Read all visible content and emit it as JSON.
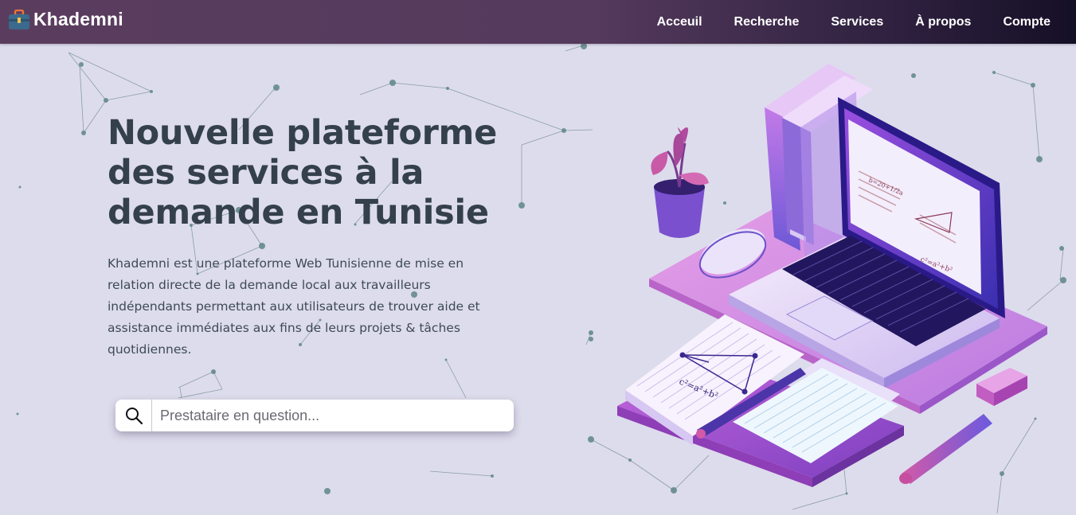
{
  "navbar": {
    "brand": "Khademni",
    "brand_icon": "briefcase-icon",
    "links": [
      "Acceuil",
      "Recherche",
      "Services",
      "À propos",
      "Compte"
    ],
    "gradient": [
      "#5a3d5e",
      "#150f26"
    ]
  },
  "hero": {
    "title": "Nouvelle plateforme des services à la demande en Tunisie",
    "description": "Khademni est une plateforme Web Tunisienne de mise en relation directe de la demande local aux travailleurs indépendants permettant aux utilisateurs de trouver aide et assistance immédiates aux fins de leurs projets & tâches quotidiennes."
  },
  "search": {
    "icon": "search-icon",
    "placeholder": "Prestataire en question...",
    "value": ""
  },
  "illustration": {
    "formula_1": "c²=a²+b²",
    "formula_2": "c²=a²+b²"
  },
  "colors": {
    "background": "#dddcec",
    "title": "#34404c",
    "text": "#3e4a56",
    "accent": "#a35ad0"
  }
}
